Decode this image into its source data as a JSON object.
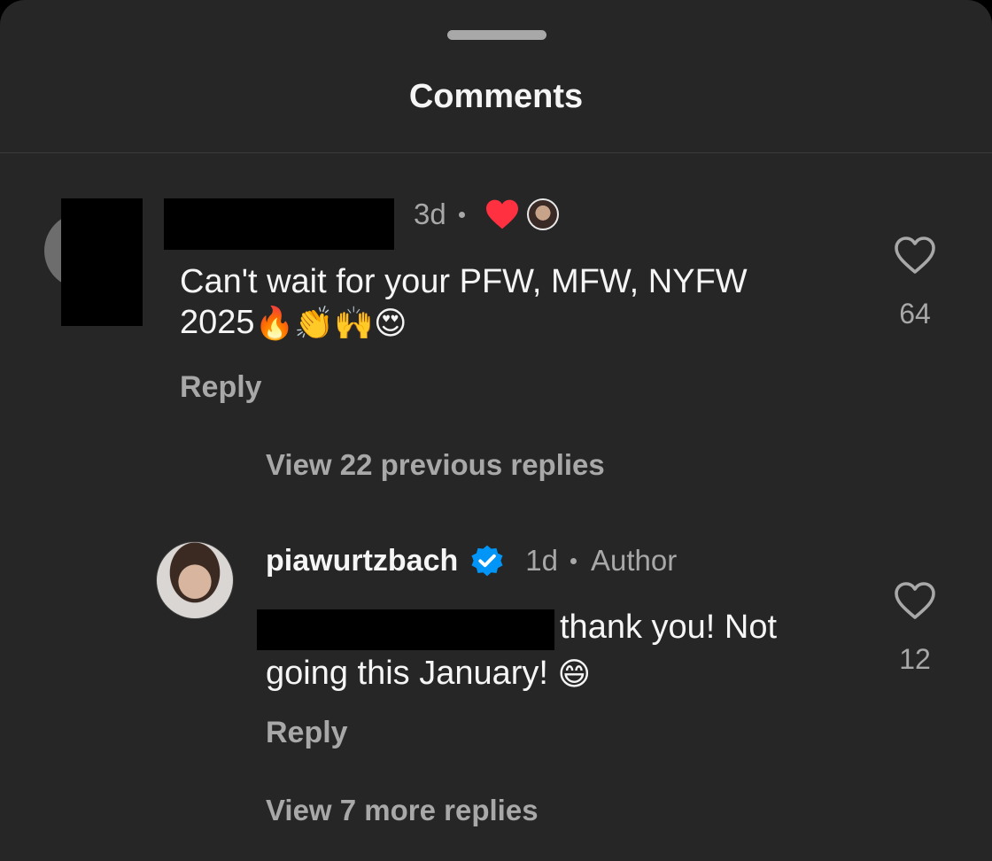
{
  "header": {
    "title": "Comments"
  },
  "comments": [
    {
      "time": "3d",
      "text_line1": "Can't wait for your PFW, MFW, NYFW",
      "text_line2": "2025",
      "emojis": [
        "🔥",
        "👏",
        "🙌",
        "😍"
      ],
      "reply_label": "Reply",
      "like_count": "64",
      "view_replies": "View 22 previous replies"
    },
    {
      "username": "piawurtzbach",
      "time": "1d",
      "badge": "Author",
      "text_line1": "thank you! Not",
      "text_line2": "going this January!",
      "emoji": "😄",
      "reply_label": "Reply",
      "like_count": "12",
      "view_replies": "View 7 more replies"
    }
  ],
  "colors": {
    "background": "#262626",
    "text_primary": "#f5f5f5",
    "text_secondary": "#a8a8a8",
    "heart_red": "#ff3040",
    "verified_blue": "#0095f6"
  },
  "icons": {
    "like": "heart-outline-icon",
    "author_liked": "heart-filled-icon",
    "verified": "verified-badge-icon"
  }
}
